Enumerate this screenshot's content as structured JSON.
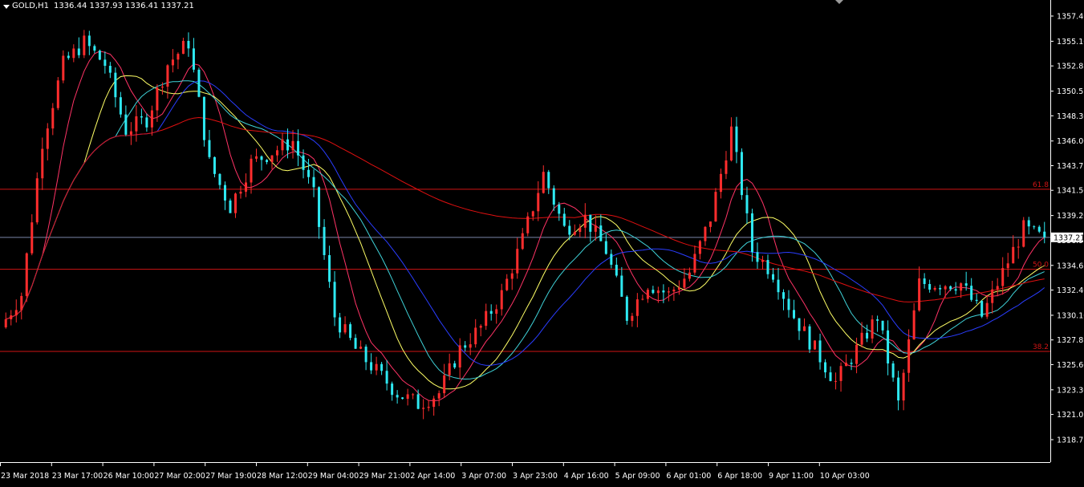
{
  "header": {
    "symbol": "GOLD,H1",
    "ohlc": "1336.44 1337.93 1336.41 1337.21"
  },
  "colors": {
    "background": "#000000",
    "axis": "#ffffff",
    "bull_candle": "#ff2d2d",
    "bear_candle": "#2ee9f2",
    "fib_line": "#d11414",
    "bid_line": "#7b86a8",
    "ma_fast": "#ff3366",
    "ma_mid": "#ffff66",
    "ma_slow": "#3fd2d8",
    "ma_slower": "#2a3dff",
    "ma_200": "#e01010"
  },
  "chart_data": {
    "type": "candlestick",
    "symbol": "GOLD",
    "timeframe": "H1",
    "last_price": "1337.21",
    "y_ticks": [
      "1357.40",
      "1355.10",
      "1352.85",
      "1350.55",
      "1348.30",
      "1346.00",
      "1343.75",
      "1341.50",
      "1339.20",
      "1336.95",
      "1334.65",
      "1332.40",
      "1330.10",
      "1327.85",
      "1325.60",
      "1323.30",
      "1321.05",
      "1318.75"
    ],
    "ylim": [
      1318.3,
      1358.5
    ],
    "x_ticks": [
      "23 Mar 2018",
      "23 Mar 17:00",
      "26 Mar 10:00",
      "27 Mar 02:00",
      "27 Mar 19:00",
      "28 Mar 12:00",
      "29 Mar 04:00",
      "29 Mar 21:00",
      "2 Apr 14:00",
      "3 Apr 07:00",
      "3 Apr 23:00",
      "4 Apr 16:00",
      "5 Apr 09:00",
      "6 Apr 01:00",
      "6 Apr 18:00",
      "9 Apr 11:00",
      "10 Apr 03:00"
    ],
    "fib_levels": [
      {
        "label": "61.8",
        "price": 1341.6
      },
      {
        "label": "50.0",
        "price": 1334.3
      },
      {
        "label": "38.2",
        "price": 1326.8
      }
    ],
    "anchor_prices": [
      1329,
      1332,
      1346,
      1353,
      1355,
      1353,
      1347,
      1348,
      1353,
      1355,
      1344,
      1340,
      1344,
      1345,
      1346,
      1341,
      1330,
      1327,
      1325,
      1323,
      1322,
      1323,
      1327,
      1329,
      1332,
      1337,
      1343,
      1338,
      1339,
      1336,
      1330,
      1333,
      1332,
      1334,
      1339,
      1347,
      1336,
      1334,
      1330,
      1327,
      1324,
      1327,
      1330,
      1322,
      1333,
      1333,
      1333,
      1330,
      1334,
      1338,
      1337
    ]
  }
}
